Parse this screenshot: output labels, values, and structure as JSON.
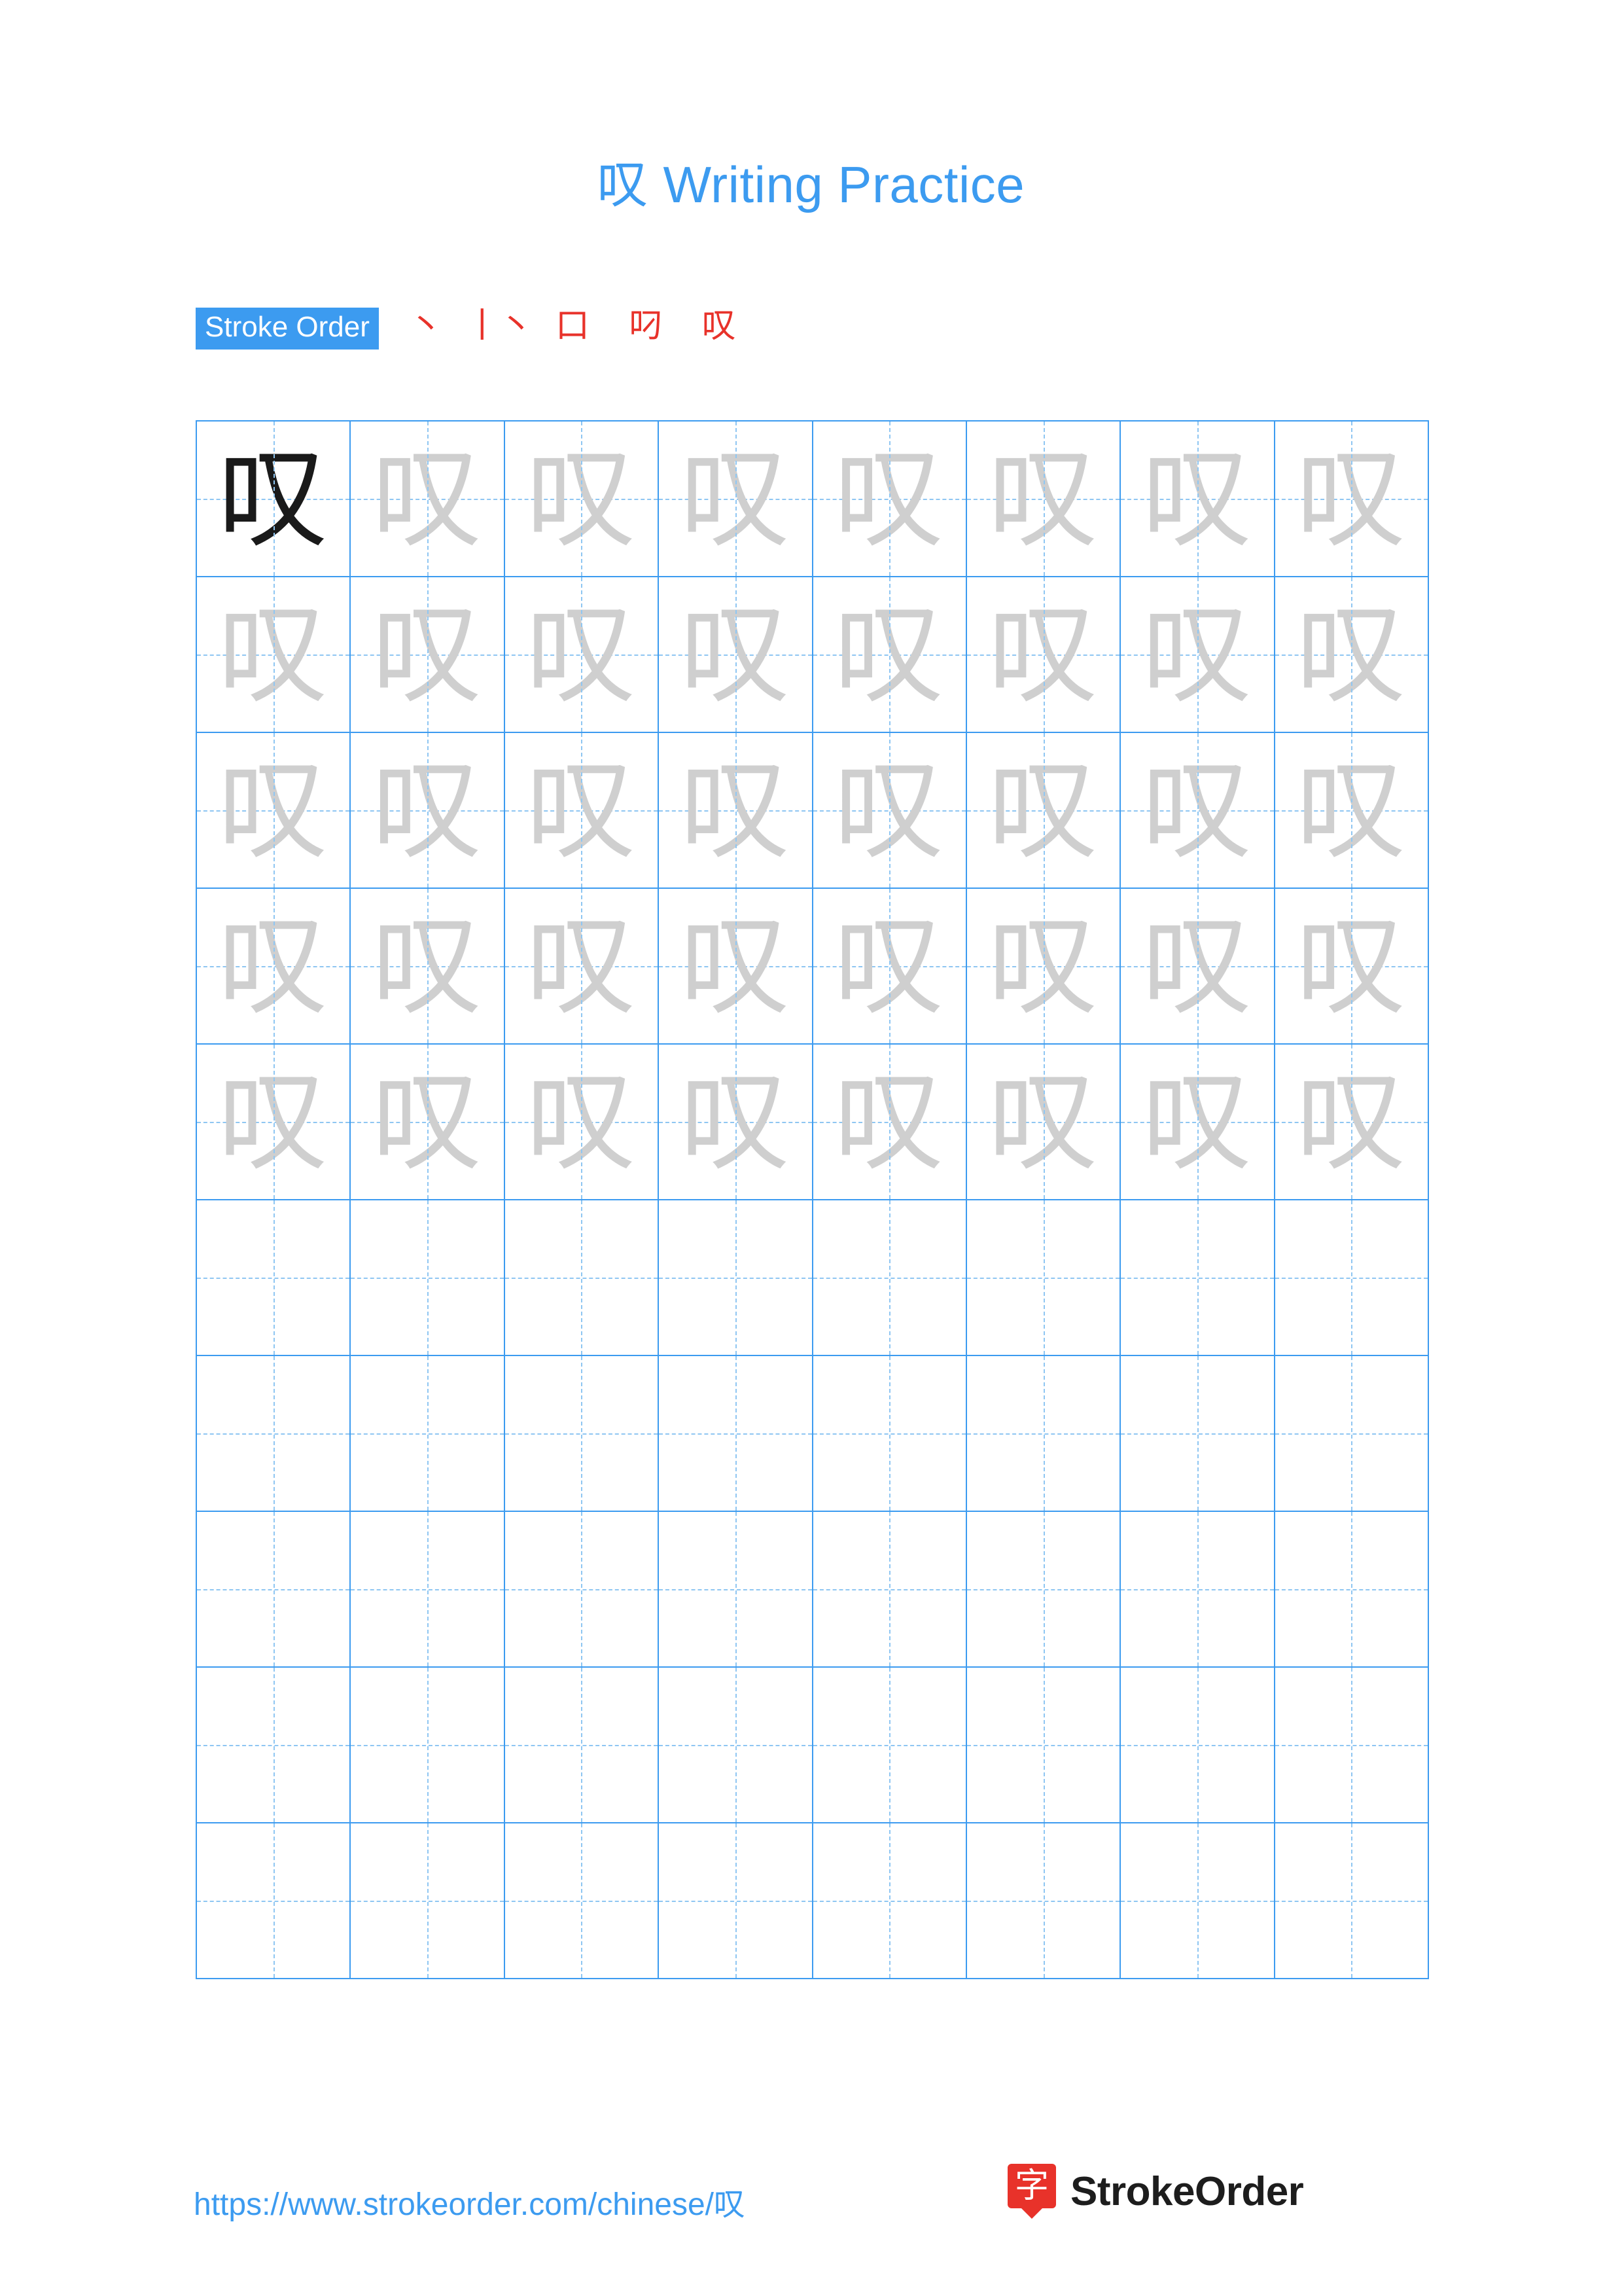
{
  "page": {
    "title": "叹 Writing Practice",
    "character": "叹"
  },
  "stroke_order": {
    "label": "Stroke Order",
    "steps": [
      "丶",
      "丨丶",
      "口",
      "叼",
      "叹"
    ]
  },
  "grid": {
    "columns": 8,
    "rows": 10,
    "cells": [
      {
        "char": "叹",
        "style": "solid"
      },
      {
        "char": "叹",
        "style": "trace"
      },
      {
        "char": "叹",
        "style": "trace"
      },
      {
        "char": "叹",
        "style": "trace"
      },
      {
        "char": "叹",
        "style": "trace"
      },
      {
        "char": "叹",
        "style": "trace"
      },
      {
        "char": "叹",
        "style": "trace"
      },
      {
        "char": "叹",
        "style": "trace"
      },
      {
        "char": "叹",
        "style": "trace"
      },
      {
        "char": "叹",
        "style": "trace"
      },
      {
        "char": "叹",
        "style": "trace"
      },
      {
        "char": "叹",
        "style": "trace"
      },
      {
        "char": "叹",
        "style": "trace"
      },
      {
        "char": "叹",
        "style": "trace"
      },
      {
        "char": "叹",
        "style": "trace"
      },
      {
        "char": "叹",
        "style": "trace"
      },
      {
        "char": "叹",
        "style": "trace"
      },
      {
        "char": "叹",
        "style": "trace"
      },
      {
        "char": "叹",
        "style": "trace"
      },
      {
        "char": "叹",
        "style": "trace"
      },
      {
        "char": "叹",
        "style": "trace"
      },
      {
        "char": "叹",
        "style": "trace"
      },
      {
        "char": "叹",
        "style": "trace"
      },
      {
        "char": "叹",
        "style": "trace"
      },
      {
        "char": "叹",
        "style": "trace"
      },
      {
        "char": "叹",
        "style": "trace"
      },
      {
        "char": "叹",
        "style": "trace"
      },
      {
        "char": "叹",
        "style": "trace"
      },
      {
        "char": "叹",
        "style": "trace"
      },
      {
        "char": "叹",
        "style": "trace"
      },
      {
        "char": "叹",
        "style": "trace"
      },
      {
        "char": "叹",
        "style": "trace"
      },
      {
        "char": "叹",
        "style": "trace"
      },
      {
        "char": "叹",
        "style": "trace"
      },
      {
        "char": "叹",
        "style": "trace"
      },
      {
        "char": "叹",
        "style": "trace"
      },
      {
        "char": "叹",
        "style": "trace"
      },
      {
        "char": "叹",
        "style": "trace"
      },
      {
        "char": "叹",
        "style": "trace"
      },
      {
        "char": "叹",
        "style": "trace"
      },
      {
        "char": "",
        "style": "empty"
      },
      {
        "char": "",
        "style": "empty"
      },
      {
        "char": "",
        "style": "empty"
      },
      {
        "char": "",
        "style": "empty"
      },
      {
        "char": "",
        "style": "empty"
      },
      {
        "char": "",
        "style": "empty"
      },
      {
        "char": "",
        "style": "empty"
      },
      {
        "char": "",
        "style": "empty"
      },
      {
        "char": "",
        "style": "empty"
      },
      {
        "char": "",
        "style": "empty"
      },
      {
        "char": "",
        "style": "empty"
      },
      {
        "char": "",
        "style": "empty"
      },
      {
        "char": "",
        "style": "empty"
      },
      {
        "char": "",
        "style": "empty"
      },
      {
        "char": "",
        "style": "empty"
      },
      {
        "char": "",
        "style": "empty"
      },
      {
        "char": "",
        "style": "empty"
      },
      {
        "char": "",
        "style": "empty"
      },
      {
        "char": "",
        "style": "empty"
      },
      {
        "char": "",
        "style": "empty"
      },
      {
        "char": "",
        "style": "empty"
      },
      {
        "char": "",
        "style": "empty"
      },
      {
        "char": "",
        "style": "empty"
      },
      {
        "char": "",
        "style": "empty"
      },
      {
        "char": "",
        "style": "empty"
      },
      {
        "char": "",
        "style": "empty"
      },
      {
        "char": "",
        "style": "empty"
      },
      {
        "char": "",
        "style": "empty"
      },
      {
        "char": "",
        "style": "empty"
      },
      {
        "char": "",
        "style": "empty"
      },
      {
        "char": "",
        "style": "empty"
      },
      {
        "char": "",
        "style": "empty"
      },
      {
        "char": "",
        "style": "empty"
      },
      {
        "char": "",
        "style": "empty"
      },
      {
        "char": "",
        "style": "empty"
      },
      {
        "char": "",
        "style": "empty"
      },
      {
        "char": "",
        "style": "empty"
      },
      {
        "char": "",
        "style": "empty"
      },
      {
        "char": "",
        "style": "empty"
      },
      {
        "char": "",
        "style": "empty"
      }
    ]
  },
  "footer": {
    "url": "https://www.strokeorder.com/chinese/叹",
    "brand_name": "StrokeOrder",
    "brand_logo_char": "字"
  },
  "colors": {
    "accent_blue": "#3c9bf0",
    "grid_line": "#3c9bf0",
    "grid_dash": "#8fc6f2",
    "stroke_red": "#e8322a",
    "trace_gray": "#cfcfcf",
    "solid_black": "#1a1a1a"
  }
}
